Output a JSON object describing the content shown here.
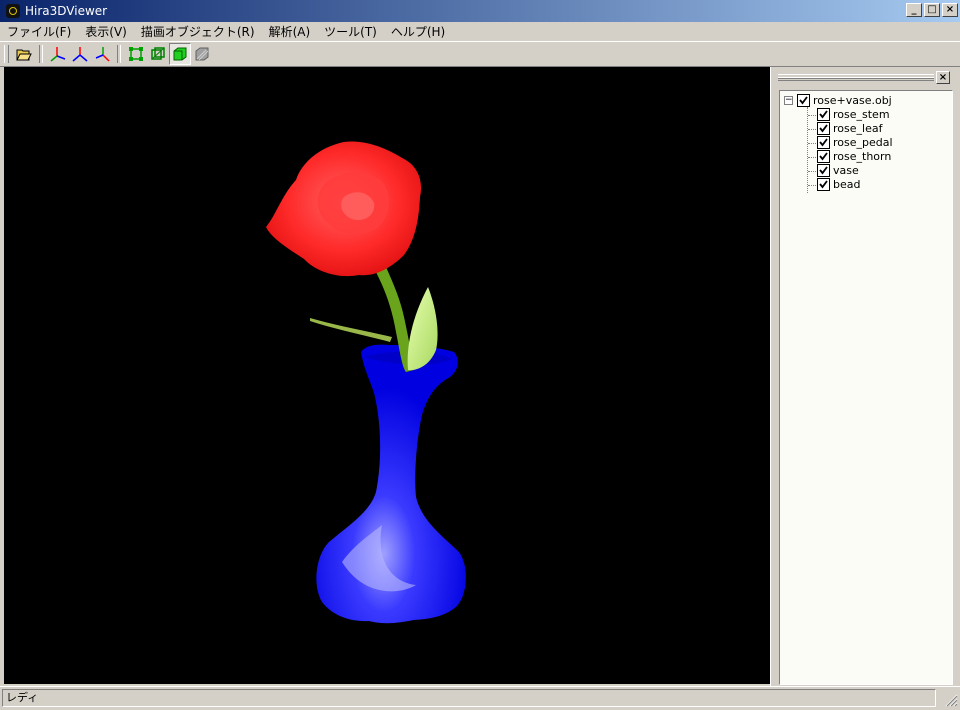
{
  "window": {
    "title": "Hira3DViewer",
    "minimize": "_",
    "maximize": "□",
    "close": "×"
  },
  "menu": [
    {
      "label": "ファイル(F)"
    },
    {
      "label": "表示(V)"
    },
    {
      "label": "描画オブジェクト(R)"
    },
    {
      "label": "解析(A)"
    },
    {
      "label": "ツール(T)"
    },
    {
      "label": "ヘルプ(H)"
    }
  ],
  "toolbar": {
    "buttons": [
      {
        "icon": "open-folder-icon",
        "pressed": false
      },
      {
        "icon": "axes-xyz-icon",
        "pressed": false
      },
      {
        "icon": "axes-xy-icon",
        "pressed": false
      },
      {
        "icon": "axes-zx-icon",
        "pressed": false
      },
      {
        "icon": "vertex-view-icon",
        "pressed": false
      },
      {
        "icon": "wireframe-view-icon",
        "pressed": false
      },
      {
        "icon": "solid-view-icon",
        "pressed": true
      },
      {
        "icon": "texture-view-icon",
        "pressed": false
      }
    ]
  },
  "tree": {
    "root": {
      "label": "rose+vase.obj",
      "checked": true,
      "expanded": true,
      "expander": "−"
    },
    "children": [
      {
        "label": "rose_stem",
        "checked": true
      },
      {
        "label": "rose_leaf",
        "checked": true
      },
      {
        "label": "rose_pedal",
        "checked": true
      },
      {
        "label": "rose_thorn",
        "checked": true
      },
      {
        "label": "vase",
        "checked": true
      },
      {
        "label": "bead",
        "checked": true
      }
    ],
    "close": "×"
  },
  "status": {
    "text": "レディ"
  },
  "colors": {
    "rose": "#ff2a2a",
    "stem": "#6aa41c",
    "leaf": "#c8f07a",
    "vase": "#1010ff",
    "background": "#000000"
  }
}
